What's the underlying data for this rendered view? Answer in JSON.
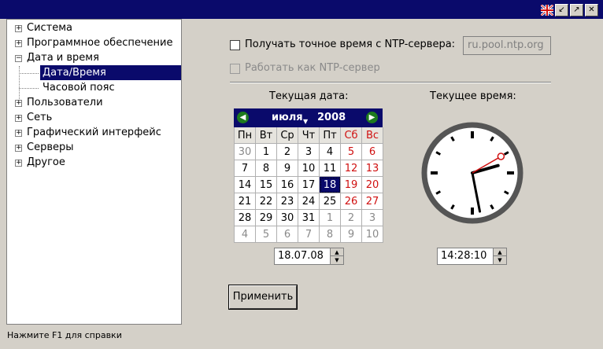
{
  "window": {
    "flag_icon": "uk-flag-icon",
    "controls": [
      "↙",
      "↗",
      "✕"
    ]
  },
  "tree": {
    "items": [
      {
        "label": "Система",
        "expander": "+"
      },
      {
        "label": "Программное обеспечение",
        "expander": "+"
      },
      {
        "label": "Дата и время",
        "expander": "−"
      },
      {
        "label": "Дата/Время"
      },
      {
        "label": "Часовой пояс"
      },
      {
        "label": "Пользователи",
        "expander": "+"
      },
      {
        "label": "Сеть",
        "expander": "+"
      },
      {
        "label": "Графический интерфейс",
        "expander": "+"
      },
      {
        "label": "Серверы",
        "expander": "+"
      },
      {
        "label": "Другое",
        "expander": "+"
      }
    ],
    "selected": "Дата/Время"
  },
  "status_bar": "Нажмите F1 для справки",
  "ntp": {
    "sync_label": "Получать точное время с NTP-сервера:",
    "server_value": "ru.pool.ntp.org",
    "serve_label": "Работать как NTP-сервер"
  },
  "date_section": {
    "title": "Текущая дата:",
    "month": "июля",
    "year": "2008",
    "weekdays": [
      "Пн",
      "Вт",
      "Ср",
      "Чт",
      "Пт",
      "Сб",
      "Вс"
    ],
    "weeks": [
      [
        "30",
        "1",
        "2",
        "3",
        "4",
        "5",
        "6"
      ],
      [
        "7",
        "8",
        "9",
        "10",
        "11",
        "12",
        "13"
      ],
      [
        "14",
        "15",
        "16",
        "17",
        "18",
        "19",
        "20"
      ],
      [
        "21",
        "22",
        "23",
        "24",
        "25",
        "26",
        "27"
      ],
      [
        "28",
        "29",
        "30",
        "31",
        "1",
        "2",
        "3"
      ],
      [
        "4",
        "5",
        "6",
        "7",
        "8",
        "9",
        "10"
      ]
    ],
    "selected_day": "18",
    "date_value": "18.07.08",
    "weekend_color": "#d01010",
    "header_color": "#0a0a6b"
  },
  "time_section": {
    "title": "Текущее время:",
    "time_value": "14:28:10",
    "hours": 14,
    "minutes": 28,
    "seconds": 10
  },
  "apply_button": "Применить"
}
